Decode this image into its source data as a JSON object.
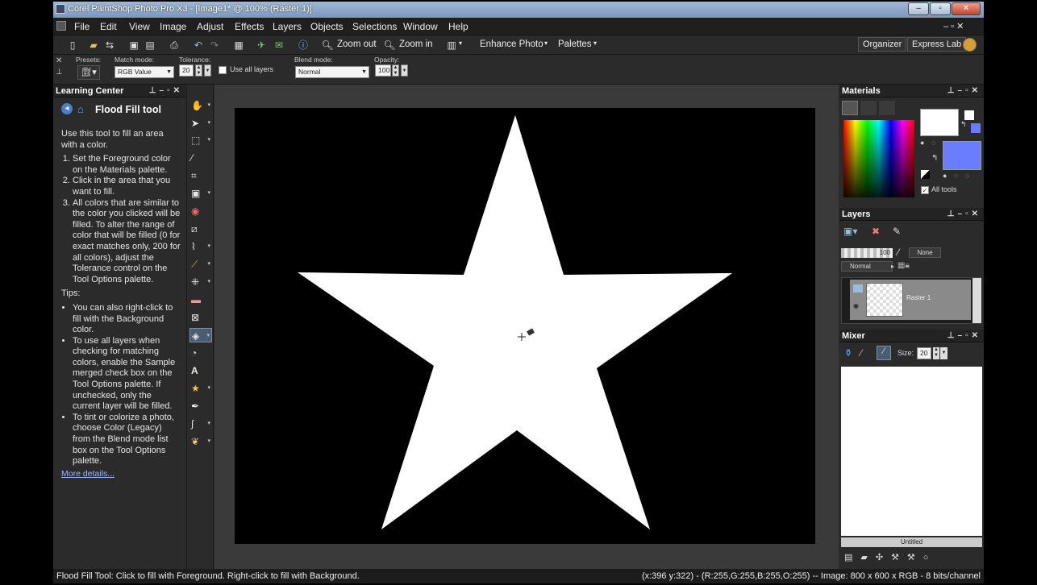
{
  "window": {
    "title": "Corel PaintShop Photo Pro X3 - [Image1* @ 100% (Raster 1)]",
    "min": "–",
    "max": "▫",
    "close": "✕"
  },
  "menu": [
    "File",
    "Edit",
    "View",
    "Image",
    "Adjust",
    "Effects",
    "Layers",
    "Objects",
    "Selections",
    "Window",
    "Help"
  ],
  "menu_right": "– ▫ ✕",
  "toolbar": {
    "zoom_out": "Zoom out",
    "zoom_in": "Zoom in",
    "enhance": "Enhance Photo",
    "palettes": "Palettes",
    "organizer": "Organizer",
    "express_lab": "Express Lab"
  },
  "tool_options": {
    "presets_label": "Presets:",
    "match_mode_label": "Match mode:",
    "match_mode_value": "RGB Value",
    "tolerance_label": "Tolerance:",
    "tolerance_value": "20",
    "use_all_layers": "Use all layers",
    "blend_mode_label": "Blend mode:",
    "blend_mode_value": "Normal",
    "opacity_label": "Opacity:",
    "opacity_value": "100"
  },
  "learning_center": {
    "header": "Learning Center",
    "title": "Flood Fill tool",
    "intro": "Use this tool to fill an area with a color.",
    "steps": [
      "Set the Foreground color on the Materials palette.",
      "Click in the area that you want to fill.",
      "All colors that are similar to the color you clicked will be filled. To alter the range of color that will be filled (0 for exact matches only, 200 for all colors), adjust the Tolerance control on the Tool Options palette."
    ],
    "tips_label": "Tips:",
    "tips": [
      "You can also right-click to fill with the Background color.",
      "To use all layers when checking for matching colors, enable the Sample merged check box on the Tool Options palette. If unchecked, only the current layer will be filled.",
      "To tint or colorize a photo, choose Color (Legacy) from the Blend mode list box on the Tool Options palette."
    ],
    "more": "More details..."
  },
  "materials": {
    "header": "Materials",
    "all_tools": "All tools",
    "foreground": "#ffffff",
    "background": "#6a7cff"
  },
  "layers": {
    "header": "Layers",
    "opacity": "100",
    "blend": "Normal",
    "none": "None",
    "layer_name": "Raster 1"
  },
  "mixer": {
    "header": "Mixer",
    "size_label": "Size:",
    "size_value": "20",
    "untitled": "Untitled"
  },
  "status": {
    "left": "Flood Fill Tool: Click to fill with Foreground. Right-click to fill with Background.",
    "right": "(x:396 y:322) - (R:255,G:255,B:255,O:255) -- Image:  800 x 600 x RGB - 8 bits/channel"
  },
  "colors": {
    "accent": "#7b98bb",
    "panel": "#2b2b2b",
    "canvas": "#000000"
  }
}
